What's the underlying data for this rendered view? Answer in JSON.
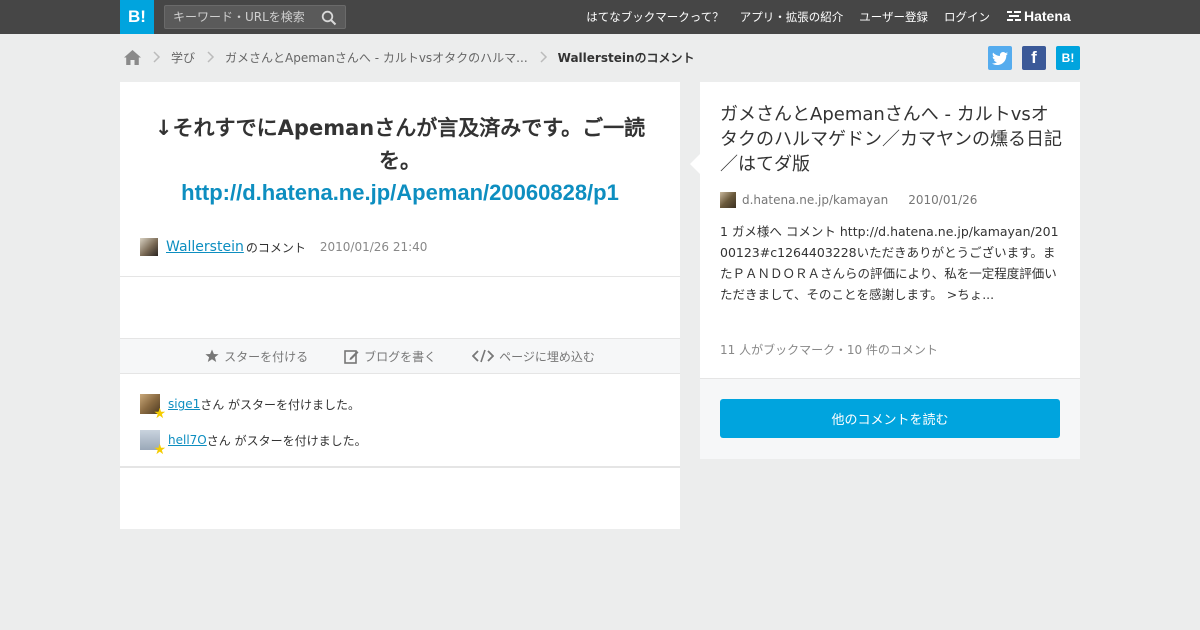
{
  "topbar": {
    "logo": "B!",
    "search_placeholder": "キーワード・URLを検索",
    "nav": [
      "はてなブックマークって？",
      "アプリ・拡張の紹介",
      "ユーザー登録",
      "ログイン"
    ],
    "brand": "Hatena"
  },
  "breadcrumb": {
    "items": [
      "学び",
      "ガメさんとApemanさんへ - カルトvsオタクのハルマ...",
      "Wallersteinのコメント"
    ]
  },
  "share": {
    "facebook": "f",
    "hatena": "B!"
  },
  "comment": {
    "text": "↓それすでにApemanさんが言及済みです。ご一読を。",
    "link": "http://d.hatena.ne.jp/Apeman/20060828/p1",
    "user": "Wallerstein",
    "user_suffix": "のコメント",
    "date": "2010/01/26 21:40"
  },
  "actions": {
    "star": "スターを付ける",
    "blog": "ブログを書く",
    "embed": "ページに埋め込む"
  },
  "stars": [
    {
      "user": "sige1",
      "text": "さん がスターを付けました。"
    },
    {
      "user": "hell7O",
      "text": "さん がスターを付けました。"
    }
  ],
  "entry": {
    "title": "ガメさんとApemanさんへ - カルトvsオタクのハルマゲドン／カマヤンの燻る日記／はてダ版",
    "domain": "d.hatena.ne.jp/kamayan",
    "date": "2010/01/26",
    "summary": "1 ガメ様へ コメント http://d.hatena.ne.jp/kamayan/20100123#c1264403228いただきありがとうございます。またＰＡＮＤＯＲＡさんらの評価により、私を一定程度評価いただきまして、そのことを感謝します。 >ちょ...",
    "counts": "11 人がブックマーク・10 件のコメント",
    "more_button": "他のコメントを読む"
  },
  "colors": {
    "accent": "#00a4de",
    "link": "#0d8ec0",
    "topbar": "#464646",
    "twitter": "#55acee",
    "facebook": "#3b5998"
  }
}
